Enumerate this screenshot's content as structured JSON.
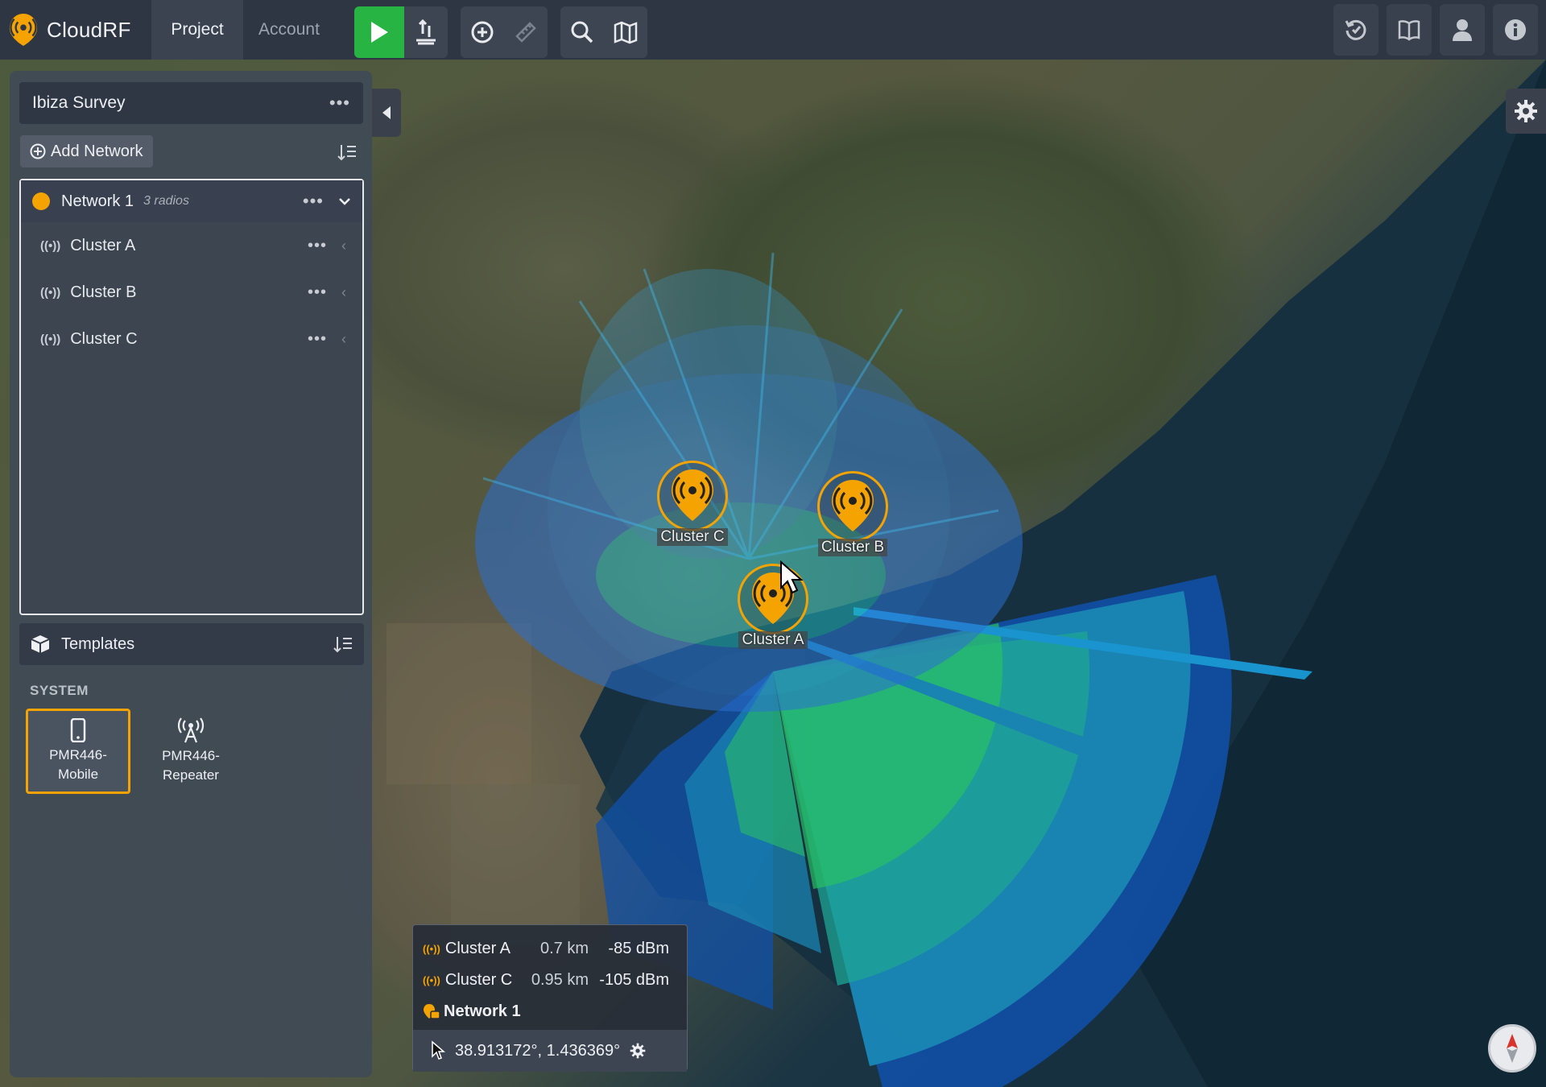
{
  "app": {
    "name": "CloudRF"
  },
  "nav": {
    "tabs": [
      {
        "label": "Project"
      },
      {
        "label": "Account"
      }
    ]
  },
  "toolbar": {
    "icons": [
      "play-icon",
      "upload-icon",
      "add-site-icon",
      "ruler-icon",
      "search-icon",
      "map-icon"
    ]
  },
  "right_toolbar": {
    "icons": [
      "history-icon",
      "book-icon",
      "user-icon",
      "info-icon"
    ]
  },
  "colors": {
    "accent": "#f5a300",
    "play": "#27b443",
    "topbar": "#2f3643",
    "panel": "#404a56"
  },
  "project": {
    "name": "Ibiza Survey"
  },
  "add_network": {
    "label": "Add Network"
  },
  "network": {
    "name": "Network 1",
    "count_label": "3 radios",
    "radios": [
      {
        "name": "Cluster A"
      },
      {
        "name": "Cluster B"
      },
      {
        "name": "Cluster C"
      }
    ]
  },
  "templates": {
    "title": "Templates",
    "section": "SYSTEM",
    "items": [
      {
        "line1": "PMR446-",
        "line2": "Mobile",
        "selected": true
      },
      {
        "line1": "PMR446-",
        "line2": "Repeater",
        "selected": false
      }
    ]
  },
  "markers": [
    {
      "label": "Cluster C"
    },
    {
      "label": "Cluster B"
    },
    {
      "label": "Cluster A"
    }
  ],
  "readout": {
    "rows": [
      {
        "name": "Cluster A",
        "distance": "0.7 km",
        "signal": "-85 dBm"
      },
      {
        "name": "Cluster C",
        "distance": "0.95 km",
        "signal": "-105 dBm"
      }
    ],
    "network": "Network 1",
    "coordinates": "38.913172°, 1.436369°"
  }
}
